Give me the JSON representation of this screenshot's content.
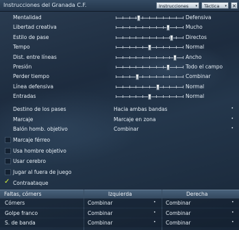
{
  "window": {
    "title": "Instrucciones del Granada C.F.",
    "instructions_button": "Instrucciones",
    "tactics_button": "Táctica",
    "close_glyph": "×"
  },
  "sliders": [
    {
      "label": "Mentalidad",
      "value": "Defensiva",
      "level": 0.33
    },
    {
      "label": "Libertad creativa",
      "value": "Mucho",
      "level": 0.77
    },
    {
      "label": "Estilo de pase",
      "value": "Directos",
      "level": 0.82
    },
    {
      "label": "Tempo",
      "value": "Normal",
      "level": 0.49
    },
    {
      "label": "Dist. entre líneas",
      "value": "Ancho",
      "level": 0.87
    },
    {
      "label": "Presión",
      "value": "Todo el campo",
      "level": 0.77
    },
    {
      "label": "Perder tiempo",
      "value": "Combinar",
      "level": 0.31
    },
    {
      "label": "Línea defensiva",
      "value": "Normal",
      "level": 0.62
    },
    {
      "label": "Entradas",
      "value": "Normal",
      "level": 0.49
    }
  ],
  "dropdowns": [
    {
      "label": "Destino de los pases",
      "value": "Hacia ambas bandas"
    },
    {
      "label": "Marcaje",
      "value": "Marcaje en zona"
    },
    {
      "label": "Balón homb. objetivo",
      "value": "Combinar"
    }
  ],
  "checkboxes": [
    {
      "label": "Marcaje férreo",
      "checked": false
    },
    {
      "label": "Usa hombre objetivo",
      "checked": false
    },
    {
      "label": "Usar cerebro",
      "checked": false
    },
    {
      "label": "Jugar al fuera de juego",
      "checked": false
    },
    {
      "label": "Contraataque",
      "checked": true
    }
  ],
  "check_glyph": "✓",
  "set_pieces": {
    "headers": {
      "name": "Faltas, córners",
      "left": "Izquierda",
      "right": "Derecha"
    },
    "rows": [
      {
        "name": "Córners",
        "left": "Combinar",
        "right": "Combinar"
      },
      {
        "name": "Golpe franco",
        "left": "Combinar",
        "right": "Combinar"
      },
      {
        "name": "S. de banda",
        "left": "Combinar",
        "right": "Combinar"
      }
    ]
  },
  "dropdown_glyph": "▾",
  "select_glyph": "•"
}
